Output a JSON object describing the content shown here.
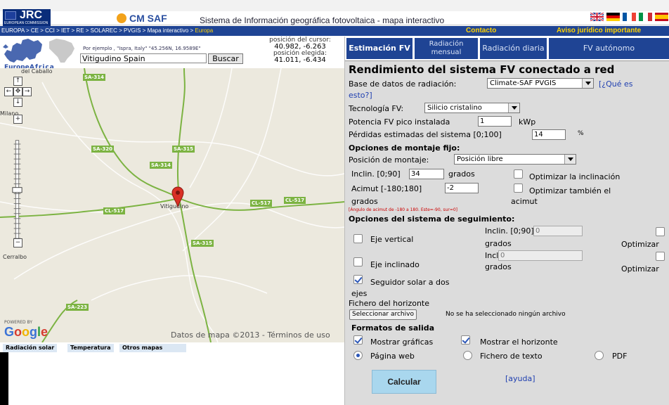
{
  "header": {
    "jrc_logo": "JRC",
    "jrc_sub": "EUROPEAN COMMISSION",
    "cmsaf_logo": "CM SAF",
    "title": "Sistema de Información geográfica fotovoltaica - mapa interactivo",
    "flags": [
      "en",
      "de",
      "fr",
      "it",
      "es"
    ]
  },
  "navbar": {
    "breadcrumb": "EUROPA > CE > CCI > IET > RE > SOLAREC > PVGIS > Mapa interactivo > ",
    "breadcrumb_current": "Europa",
    "contact": "Contacto",
    "legal": "Aviso jurídico importante"
  },
  "search": {
    "europe_label": "Europe",
    "africa_label": "Africa",
    "hint": "Por ejemplo , \"Ispra, Italy\" \"45.256N, 16.9589E\"",
    "value": "Vitigudino Spain",
    "button": "Buscar",
    "cursor_label": "posición del cursor:",
    "cursor_value": "40.982, -6.263",
    "selected_label": "posición elegida:",
    "selected_value": "41.011, -6.434"
  },
  "map": {
    "place_labels": [
      "del Caballo",
      "Milano",
      "Vitigudino",
      "Cerralbo"
    ],
    "road_labels": [
      "SA-314",
      "SA-320",
      "SA-315",
      "SA-314",
      "CL-517",
      "CL-517",
      "CL-517",
      "SA-315",
      "SA-223"
    ],
    "powered_by": "POWERED BY",
    "google": "Google",
    "attribution": "Datos de mapa ©2013 - Términos de uso",
    "tabs": [
      "Radiación solar",
      "Temperatura",
      "Otros mapas"
    ]
  },
  "tabs": [
    "Estimación FV",
    "Radiación mensual",
    "Radiación diaria",
    "FV autónomo"
  ],
  "form": {
    "title": "Rendimiento del sistema FV conectado a red",
    "radiation_db_label": "Base de datos de radiación:",
    "radiation_db_value": "Climate-SAF PVGIS",
    "whats_this_1": "[¿Qué es",
    "whats_this_2": "esto?]",
    "tech_label": "Tecnología FV:",
    "tech_value": "Silicio cristalino",
    "power_label": "Potencia FV pico instalada",
    "power_value": "1",
    "power_unit": "kWp",
    "losses_label": "Pérdidas estimadas del sistema [0;100]",
    "losses_value": "14",
    "losses_unit": "%",
    "fixed_header": "Opciones de montaje fijo:",
    "mount_label": "Posición de montaje:",
    "mount_value": "Posición libre",
    "incl_label": "Inclin. [0;90]",
    "incl_value": "34",
    "grados": "grados",
    "opt_incl": "Optimizar la inclinación",
    "azim_label": "Acimut [-180;180]",
    "azim_value": "-2",
    "opt_azim_1": "Optimizar también el",
    "opt_azim_2": "acimut",
    "azim_note": "[Ángulo de acimut de -180 a 180. Este=-90, sur=0]",
    "tracking_header": "Opciones del sistema de seguimiento:",
    "vertical_axis": "Eje vertical",
    "inclined_axis": "Eje inclinado",
    "track_incl_label": "Inclin. [0;90]",
    "track_incl_value": "0",
    "optimize": "Optimizar",
    "two_axis_1": "Seguidor solar a dos",
    "two_axis_2": "ejes",
    "horizon_label": "Fichero del horizonte",
    "file_button": "Seleccionar archivo",
    "file_status": "No se ha seleccionado ningún archivo",
    "output_header": "Formatos de salida",
    "show_graphs": "Mostrar gráficas",
    "show_horizon": "Mostrar el horizonte",
    "web_page": "Página web",
    "text_file": "Fichero de texto",
    "pdf": "PDF",
    "calculate": "Calcular",
    "help": "[ayuda]"
  },
  "colors": {
    "nav_blue": "#1f4494",
    "link_yellow": "#ffd200",
    "form_bg": "#dcdcdc",
    "button_blue": "#a9d7ee",
    "road_green": "#7cb342"
  }
}
